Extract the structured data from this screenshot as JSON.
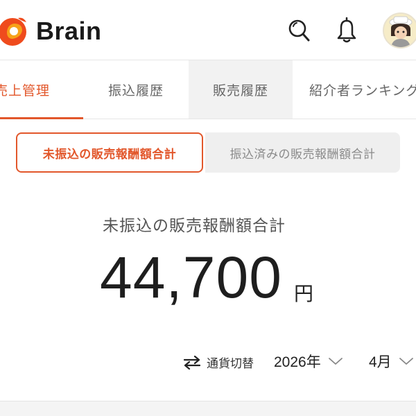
{
  "header": {
    "brand": "Brain",
    "icons": [
      "search-icon",
      "bell-icon",
      "avatar"
    ]
  },
  "tabs": [
    {
      "label": "売上管理",
      "active": true
    },
    {
      "label": "振込履歴",
      "active": false
    },
    {
      "label": "販売履歴",
      "active": false
    },
    {
      "label": "紹介者ランキング",
      "active": false
    }
  ],
  "toggle": {
    "unpaid_label": "未振込の販売報酬額合計",
    "paid_label": "振込済みの販売報酬額合計"
  },
  "summary": {
    "label": "未振込の販売報酬額合計",
    "amount": "44,700",
    "unit": "円"
  },
  "controls": {
    "currency_switch_label": "通貨切替",
    "year": "2026年",
    "month": "4月"
  },
  "colors": {
    "accent": "#e2572b",
    "text": "#222222",
    "muted": "#8a8a8a"
  }
}
